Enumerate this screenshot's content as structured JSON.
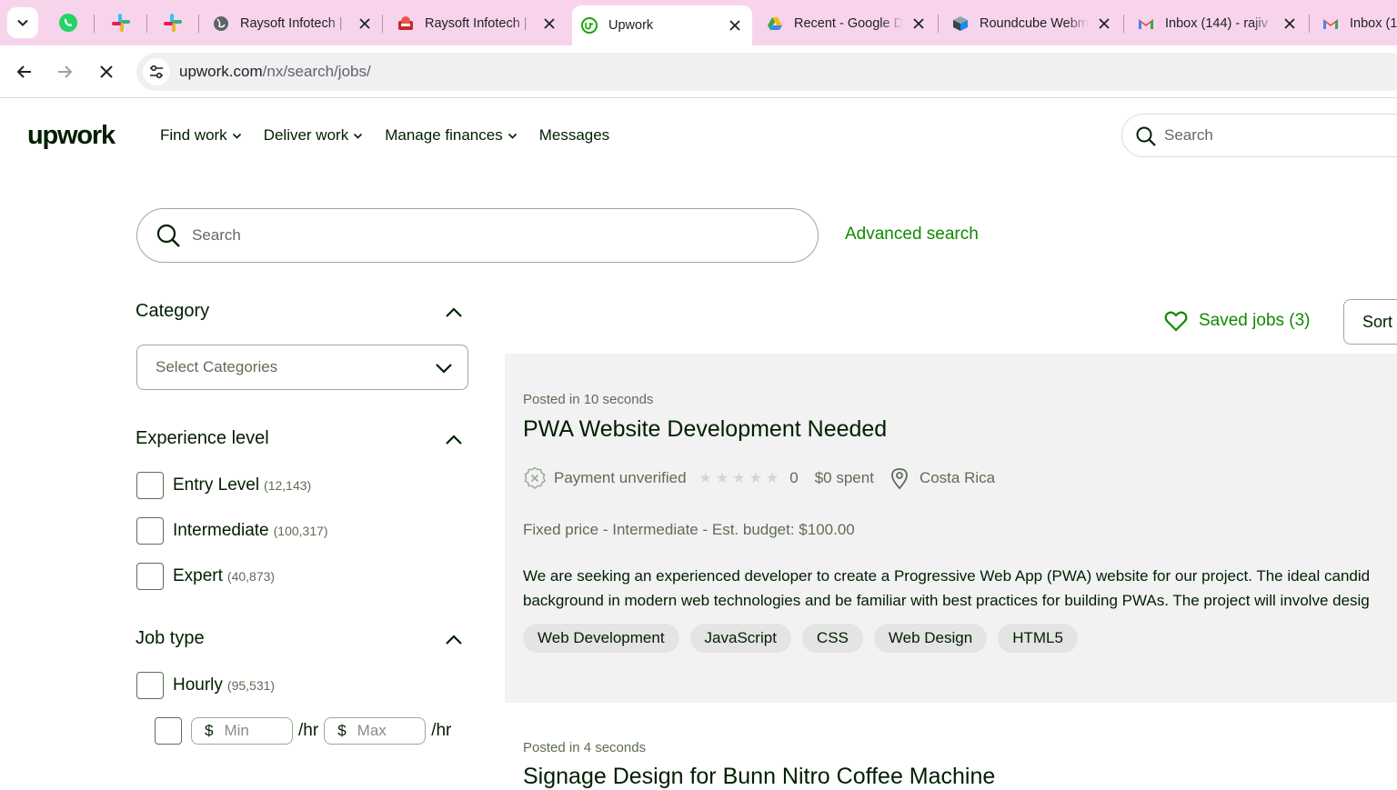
{
  "browser": {
    "tabs": [
      {
        "title": "Raysoft Infotech | ",
        "active": false
      },
      {
        "title": "Raysoft Infotech | ",
        "active": false
      },
      {
        "title": "Upwork",
        "active": true
      },
      {
        "title": "Recent - Google Drive",
        "active": false
      },
      {
        "title": "Roundcube Webmail",
        "active": false
      },
      {
        "title": "Inbox (144) - rajiv",
        "active": false
      },
      {
        "title": "Inbox (1",
        "active": false
      }
    ],
    "url_host": "upwork.com",
    "url_path": "/nx/search/jobs/"
  },
  "header": {
    "logo": "upwork",
    "nav": [
      "Find work",
      "Deliver work",
      "Manage finances",
      "Messages"
    ],
    "search_placeholder": "Search"
  },
  "search": {
    "placeholder": "Search",
    "advanced_label": "Advanced search"
  },
  "filters": {
    "category": {
      "title": "Category",
      "select_placeholder": "Select Categories"
    },
    "experience": {
      "title": "Experience level",
      "options": [
        {
          "label": "Entry Level",
          "count": "(12,143)"
        },
        {
          "label": "Intermediate",
          "count": "(100,317)"
        },
        {
          "label": "Expert",
          "count": "(40,873)"
        }
      ]
    },
    "job_type": {
      "title": "Job type",
      "hourly": {
        "label": "Hourly",
        "count": "(95,531)"
      },
      "currency": "$",
      "min_placeholder": "Min",
      "max_placeholder": "Max",
      "unit": "/hr"
    }
  },
  "results": {
    "saved_jobs": "Saved jobs (3)",
    "sort_label": "Sort",
    "jobs": [
      {
        "posted": "Posted in 10 seconds",
        "title": "PWA Website Development Needed",
        "payment": "Payment unverified",
        "rating": "0",
        "spent": "$0 spent",
        "location": "Costa Rica",
        "type": "Fixed price - Intermediate - Est. budget: $100.00",
        "desc_line1": "We are seeking an experienced developer to create a Progressive Web App (PWA) website for our project. The ideal candid",
        "desc_line2": "background in modern web technologies and be familiar with best practices for building PWAs. The project will involve desig",
        "tags": [
          "Web Development",
          "JavaScript",
          "CSS",
          "Web Design",
          "HTML5"
        ]
      },
      {
        "posted": "Posted in 4 seconds",
        "title": "Signage Design for Bunn Nitro Coffee Machine"
      }
    ]
  },
  "colors": {
    "brand_green": "#108a00",
    "tab_strip": "#f8d4ec"
  }
}
